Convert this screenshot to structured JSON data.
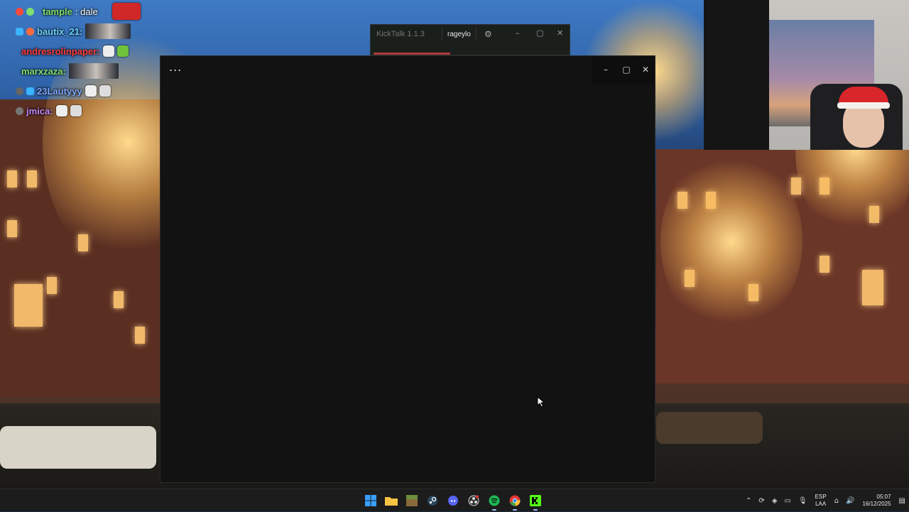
{
  "chat": {
    "lines": [
      {
        "user": "tample",
        "user_color": "#7ee06d",
        "message": ": dale"
      },
      {
        "user": "bautix_21:",
        "user_color": "#6dd6ff",
        "message": ""
      },
      {
        "user": "andresrolinpaper:",
        "user_color": "#ff3b3b",
        "message": ""
      },
      {
        "user": "marxzaza:",
        "user_color": "#7ee06d",
        "message": ""
      },
      {
        "user": "23Lautyyy",
        "user_color": "#7fa8ff",
        "message": ""
      },
      {
        "user": "jmica:",
        "user_color": "#c58bff",
        "message": ""
      }
    ]
  },
  "kicktalk": {
    "title": "KickTalk 1.1.3",
    "username": "rageylo"
  },
  "main_window": {
    "menu_label": "..."
  },
  "taskbar": {
    "icons": [
      "windows-start-icon",
      "file-explorer-icon",
      "minecraft-icon",
      "steam-icon",
      "discord-icon",
      "obs-icon",
      "spotify-icon",
      "chrome-icon",
      "kick-icon"
    ],
    "lang_top": "ESP",
    "lang_bottom": "LAA",
    "time": "05:07",
    "date": "16/12/2025"
  },
  "colors": {
    "window_bg": "#121212",
    "taskbar_bg": "#1c1c1c",
    "kick_green": "#53fc18",
    "spotify_green": "#1db954"
  }
}
